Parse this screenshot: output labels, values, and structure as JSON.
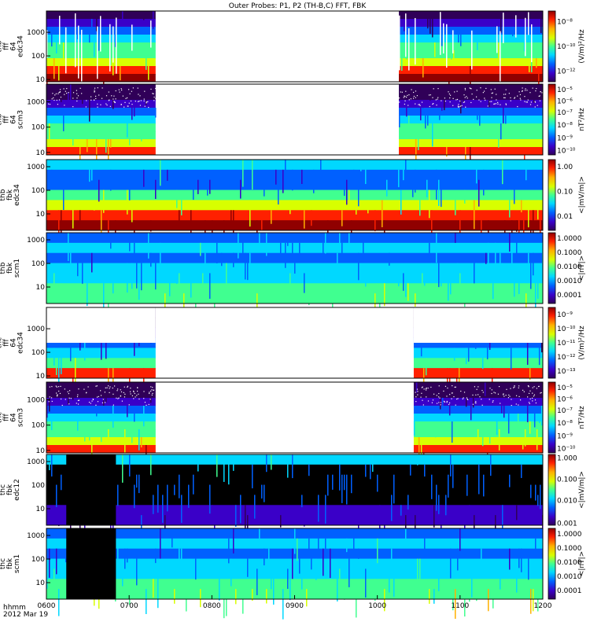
{
  "chart_data": {
    "type": "heatmap",
    "title": "Outer Probes: P1, P2 (TH-B,C) FFT, FBK",
    "x_axis": {
      "label_line1": "hhmm",
      "label_line2": "2012 Mar 19",
      "ticks": [
        "0600",
        "0700",
        "0800",
        "0900",
        "1000",
        "1100",
        "1200"
      ],
      "range": [
        "0600",
        "1200"
      ]
    },
    "panels": [
      {
        "label_lines": [
          "thb",
          "fff",
          "64",
          "edc34"
        ],
        "y_scale": "log",
        "y_range": [
          8,
          8000
        ],
        "y_ticks": [
          "10",
          "100",
          "1000"
        ],
        "colorbar_unit": "(V/m)²/Hz",
        "colorbar_ticks": [
          "10⁻⁸",
          "10⁻¹⁰",
          "10⁻¹²"
        ],
        "colorbar_tick_pos": [
          0.85,
          0.5,
          0.15
        ],
        "style": "spectro",
        "segments": [
          [
            0.0,
            0.22
          ],
          [
            0.71,
            1.0
          ]
        ],
        "burst_tail": true
      },
      {
        "label_lines": [
          "thb",
          "fff",
          "64",
          "scm3"
        ],
        "y_scale": "log",
        "y_range": [
          8,
          5000
        ],
        "y_ticks": [
          "10",
          "100",
          "1000"
        ],
        "colorbar_unit": "nT²/Hz",
        "colorbar_ticks": [
          "10⁻⁵",
          "10⁻⁶",
          "10⁻⁷",
          "10⁻⁸",
          "10⁻⁹",
          "10⁻¹⁰"
        ],
        "colorbar_tick_pos": [
          0.92,
          0.76,
          0.6,
          0.42,
          0.24,
          0.06
        ],
        "style": "scm",
        "segments": [
          [
            0.0,
            0.22
          ],
          [
            0.71,
            1.0
          ]
        ]
      },
      {
        "label_lines": [
          "thb",
          "fbk",
          "edc34"
        ],
        "y_scale": "log",
        "y_range": [
          2,
          2000
        ],
        "y_ticks": [
          "10",
          "100",
          "1000"
        ],
        "colorbar_unit": "<|mV/m|>",
        "colorbar_ticks": [
          "1.00",
          "0.10",
          "0.01"
        ],
        "colorbar_tick_pos": [
          0.9,
          0.55,
          0.2
        ],
        "style": "fbk_edc",
        "segments": [
          [
            0.0,
            1.0
          ]
        ]
      },
      {
        "label_lines": [
          "thb",
          "fbk",
          "scm1"
        ],
        "y_scale": "log",
        "y_range": [
          2,
          2000
        ],
        "y_ticks": [
          "10",
          "100",
          "1000"
        ],
        "colorbar_unit": "<|nT|>",
        "colorbar_ticks": [
          "1.0000",
          "0.1000",
          "0.0100",
          "0.0010",
          "0.0001"
        ],
        "colorbar_tick_pos": [
          0.92,
          0.72,
          0.52,
          0.32,
          0.12
        ],
        "style": "fbk_scm",
        "segments": [
          [
            0.0,
            1.0
          ]
        ]
      },
      {
        "label_lines": [
          "thc",
          "fff",
          "64",
          "edc34"
        ],
        "y_scale": "log",
        "y_range": [
          8,
          8000
        ],
        "y_ticks": [
          "10",
          "100",
          "1000"
        ],
        "colorbar_unit": "(V/m)²/Hz",
        "colorbar_ticks": [
          "10⁻⁹",
          "10⁻¹⁰",
          "10⁻¹¹",
          "10⁻¹²",
          "10⁻¹³"
        ],
        "colorbar_tick_pos": [
          0.9,
          0.7,
          0.5,
          0.3,
          0.1
        ],
        "style": "thc_edc",
        "segments": [
          [
            0.0,
            0.22
          ],
          [
            0.74,
            1.0
          ]
        ]
      },
      {
        "label_lines": [
          "thc",
          "fff",
          "64",
          "scm3"
        ],
        "y_scale": "log",
        "y_range": [
          8,
          5000
        ],
        "y_ticks": [
          "10",
          "100",
          "1000"
        ],
        "colorbar_unit": "nT²/Hz",
        "colorbar_ticks": [
          "10⁻⁵",
          "10⁻⁶",
          "10⁻⁷",
          "10⁻⁸",
          "10⁻⁹",
          "10⁻¹⁰"
        ],
        "colorbar_tick_pos": [
          0.92,
          0.76,
          0.6,
          0.42,
          0.24,
          0.06
        ],
        "style": "scm",
        "segments": [
          [
            0.0,
            0.22
          ],
          [
            0.74,
            1.0
          ]
        ]
      },
      {
        "label_lines": [
          "thc",
          "fbk",
          "edc12"
        ],
        "y_scale": "log",
        "y_range": [
          2,
          2000
        ],
        "y_ticks": [
          "10",
          "100",
          "1000"
        ],
        "colorbar_unit": "<|mV/m|>",
        "colorbar_ticks": [
          "1.000",
          "0.100",
          "0.010",
          "0.001"
        ],
        "colorbar_tick_pos": [
          0.95,
          0.65,
          0.35,
          0.03
        ],
        "style": "thc_fbk_edc",
        "segments": [
          [
            0.0,
            1.0
          ]
        ],
        "black_spans": [
          [
            0.04,
            0.14
          ]
        ]
      },
      {
        "label_lines": [
          "thc",
          "fbk",
          "scm1"
        ],
        "y_scale": "log",
        "y_range": [
          2,
          2000
        ],
        "y_ticks": [
          "10",
          "100",
          "1000"
        ],
        "colorbar_unit": "<|nT|>",
        "colorbar_ticks": [
          "1.0000",
          "0.1000",
          "0.0100",
          "0.0010",
          "0.0001"
        ],
        "colorbar_tick_pos": [
          0.92,
          0.72,
          0.52,
          0.32,
          0.12
        ],
        "style": "fbk_scm",
        "segments": [
          [
            0.0,
            1.0
          ]
        ],
        "black_spans": [
          [
            0.04,
            0.14
          ]
        ]
      }
    ]
  }
}
